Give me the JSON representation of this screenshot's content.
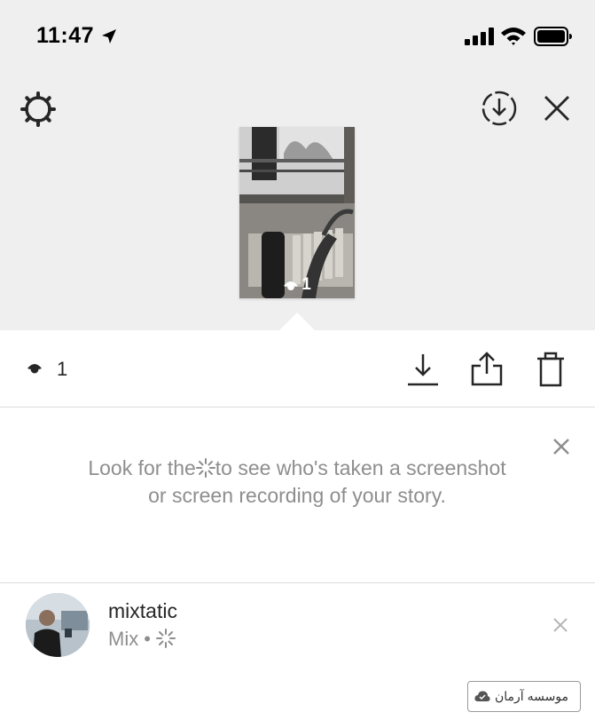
{
  "status_bar": {
    "time": "11:47"
  },
  "story_preview": {
    "view_count": "1"
  },
  "actions": {
    "view_count": "1"
  },
  "tip": {
    "text": "Look for the     to see who's taken a screenshot or screen recording of your story.",
    "before": "Look for the",
    "after": "to see who's taken a screenshot or screen recording of your story."
  },
  "viewers": [
    {
      "username": "mixtatic",
      "name": "Mix"
    }
  ],
  "watermark": {
    "text": "موسسه آرمان"
  },
  "icons": [
    "location-arrow-icon",
    "signal-icon",
    "wifi-icon",
    "battery-icon",
    "gear-icon",
    "download-circle-icon",
    "close-icon",
    "eye-icon",
    "download-icon",
    "share-icon",
    "trash-icon",
    "screenshot-spark-icon",
    "cloud-icon"
  ]
}
